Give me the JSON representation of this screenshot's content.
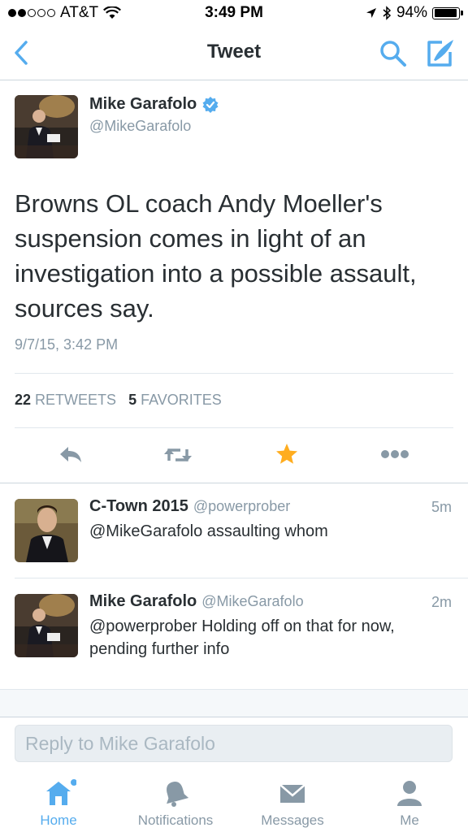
{
  "status_bar": {
    "carrier": "AT&T",
    "time": "3:49 PM",
    "battery": "94%",
    "battery_level": 0.94
  },
  "nav": {
    "title": "Tweet"
  },
  "tweet": {
    "author_name": "Mike Garafolo",
    "author_handle": "@MikeGarafolo",
    "text": "Browns OL coach Andy Moeller's suspension comes in light of an investigation into a possible assault, sources say.",
    "timestamp": "9/7/15, 3:42 PM",
    "retweet_count": "22",
    "retweet_label": "RETWEETS",
    "favorite_count": "5",
    "favorite_label": "FAVORITES"
  },
  "replies": [
    {
      "name": "C-Town 2015",
      "handle": "@powerprober",
      "ago": "5m",
      "text": "@MikeGarafolo assaulting whom"
    },
    {
      "name": "Mike Garafolo",
      "handle": "@MikeGarafolo",
      "ago": "2m",
      "text": "@powerprober Holding off on that for now, pending further info"
    }
  ],
  "reply_box": {
    "placeholder": "Reply to Mike Garafolo"
  },
  "tabs": [
    {
      "label": "Home",
      "icon": "home-icon",
      "active": true
    },
    {
      "label": "Notifications",
      "icon": "bell-icon"
    },
    {
      "label": "Messages",
      "icon": "envelope-icon"
    },
    {
      "label": "Me",
      "icon": "person-icon"
    }
  ],
  "colors": {
    "accent": "#55acee",
    "favorite": "#ffad1f",
    "text": "#292f33",
    "muted": "#8899a6"
  }
}
